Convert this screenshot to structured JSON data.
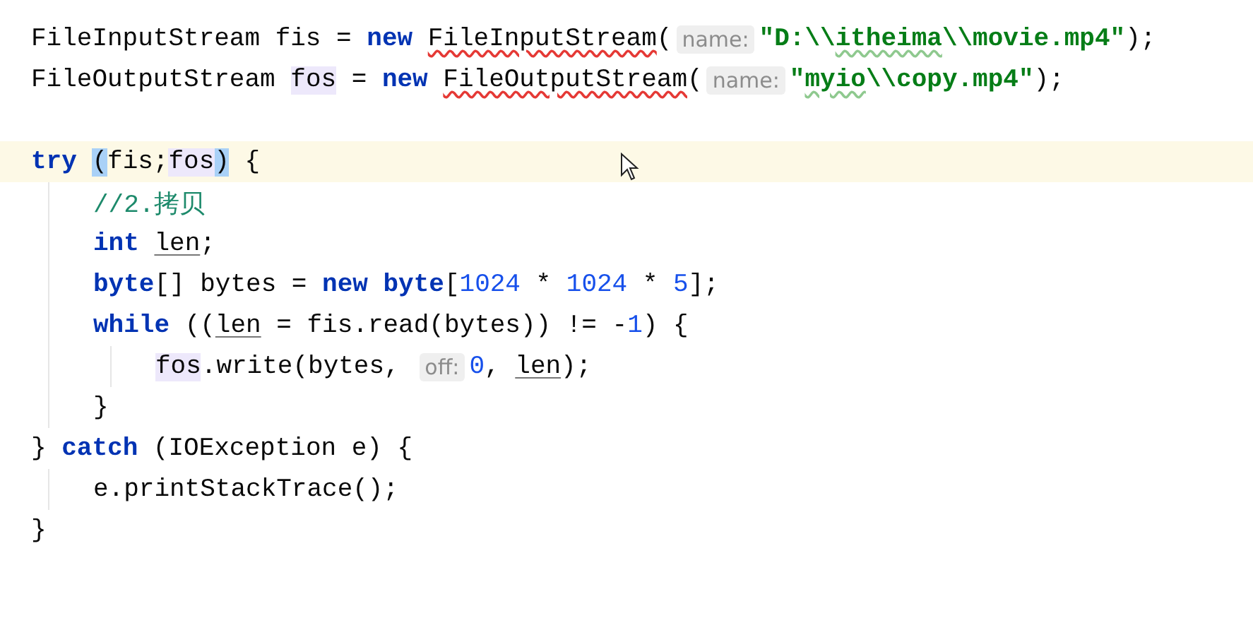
{
  "editor": {
    "lines": [
      {
        "kind": "code",
        "current": false,
        "tokens": [
          {
            "kind": "plain",
            "text": "FileInputStream fis = "
          },
          {
            "kind": "keyword",
            "text": "new "
          },
          {
            "kind": "squiggle",
            "text": "FileInputStream"
          },
          {
            "kind": "plain",
            "text": "("
          },
          {
            "kind": "hint",
            "text": "name:"
          },
          {
            "kind": "string",
            "text": "\"D:\\\\"
          },
          {
            "kind": "typo",
            "text": "itheima"
          },
          {
            "kind": "string",
            "text": "\\\\movie.mp4\""
          },
          {
            "kind": "plain",
            "text": ");"
          }
        ]
      },
      {
        "kind": "code",
        "current": false,
        "tokens": [
          {
            "kind": "plain",
            "text": "FileOutputStream "
          },
          {
            "kind": "usage",
            "text": "fos"
          },
          {
            "kind": "plain",
            "text": " = "
          },
          {
            "kind": "keyword",
            "text": "new "
          },
          {
            "kind": "squiggle",
            "text": "FileOutputStream"
          },
          {
            "kind": "plain",
            "text": "("
          },
          {
            "kind": "hint",
            "text": "name:"
          },
          {
            "kind": "string",
            "text": "\""
          },
          {
            "kind": "typo",
            "text": "myio"
          },
          {
            "kind": "string",
            "text": "\\\\copy.mp4\""
          },
          {
            "kind": "plain",
            "text": ");"
          }
        ]
      },
      {
        "kind": "blank",
        "current": false
      },
      {
        "kind": "code",
        "current": true,
        "tokens": [
          {
            "kind": "keyword",
            "text": "try "
          },
          {
            "kind": "match",
            "text": "("
          },
          {
            "kind": "plain",
            "text": "fis;"
          },
          {
            "kind": "usage",
            "text": "fos"
          },
          {
            "kind": "match",
            "text": ")"
          },
          {
            "kind": "plain",
            "text": " {"
          }
        ],
        "children": [
          {
            "kind": "code",
            "current": false,
            "tokens": [
              {
                "kind": "comment",
                "text": "//2.拷贝"
              }
            ]
          },
          {
            "kind": "code",
            "current": false,
            "tokens": [
              {
                "kind": "keyword",
                "text": "int "
              },
              {
                "kind": "underlined",
                "text": "len"
              },
              {
                "kind": "plain",
                "text": ";"
              }
            ]
          },
          {
            "kind": "code",
            "current": false,
            "tokens": [
              {
                "kind": "keyword",
                "text": "byte"
              },
              {
                "kind": "plain",
                "text": "[] bytes = "
              },
              {
                "kind": "keyword",
                "text": "new byte"
              },
              {
                "kind": "plain",
                "text": "["
              },
              {
                "kind": "number",
                "text": "1024"
              },
              {
                "kind": "plain",
                "text": " * "
              },
              {
                "kind": "number",
                "text": "1024"
              },
              {
                "kind": "plain",
                "text": " * "
              },
              {
                "kind": "number",
                "text": "5"
              },
              {
                "kind": "plain",
                "text": "];"
              }
            ]
          },
          {
            "kind": "code",
            "current": false,
            "tokens": [
              {
                "kind": "keyword",
                "text": "while"
              },
              {
                "kind": "plain",
                "text": " (("
              },
              {
                "kind": "underlined",
                "text": "len"
              },
              {
                "kind": "plain",
                "text": " = fis.read(bytes)) != -"
              },
              {
                "kind": "number",
                "text": "1"
              },
              {
                "kind": "plain",
                "text": ") {"
              }
            ],
            "children": [
              {
                "kind": "code",
                "current": false,
                "tokens": [
                  {
                    "kind": "usage",
                    "text": "fos"
                  },
                  {
                    "kind": "plain",
                    "text": ".write(bytes, "
                  },
                  {
                    "kind": "hint",
                    "text": "off:"
                  },
                  {
                    "kind": "number",
                    "text": "0"
                  },
                  {
                    "kind": "plain",
                    "text": ", "
                  },
                  {
                    "kind": "underlined",
                    "text": "len"
                  },
                  {
                    "kind": "plain",
                    "text": ");"
                  }
                ]
              }
            ]
          },
          {
            "kind": "code",
            "current": false,
            "tokens": [
              {
                "kind": "plain",
                "text": "}"
              }
            ]
          }
        ]
      },
      {
        "kind": "code",
        "current": false,
        "tokens": [
          {
            "kind": "plain",
            "text": "} "
          },
          {
            "kind": "keyword",
            "text": "catch"
          },
          {
            "kind": "plain",
            "text": " (IOException e) {"
          }
        ],
        "children": [
          {
            "kind": "code",
            "current": false,
            "tokens": [
              {
                "kind": "plain",
                "text": "e.printStackTrace();"
              }
            ]
          }
        ]
      },
      {
        "kind": "code",
        "current": false,
        "tokens": [
          {
            "kind": "plain",
            "text": "}"
          }
        ]
      }
    ]
  }
}
